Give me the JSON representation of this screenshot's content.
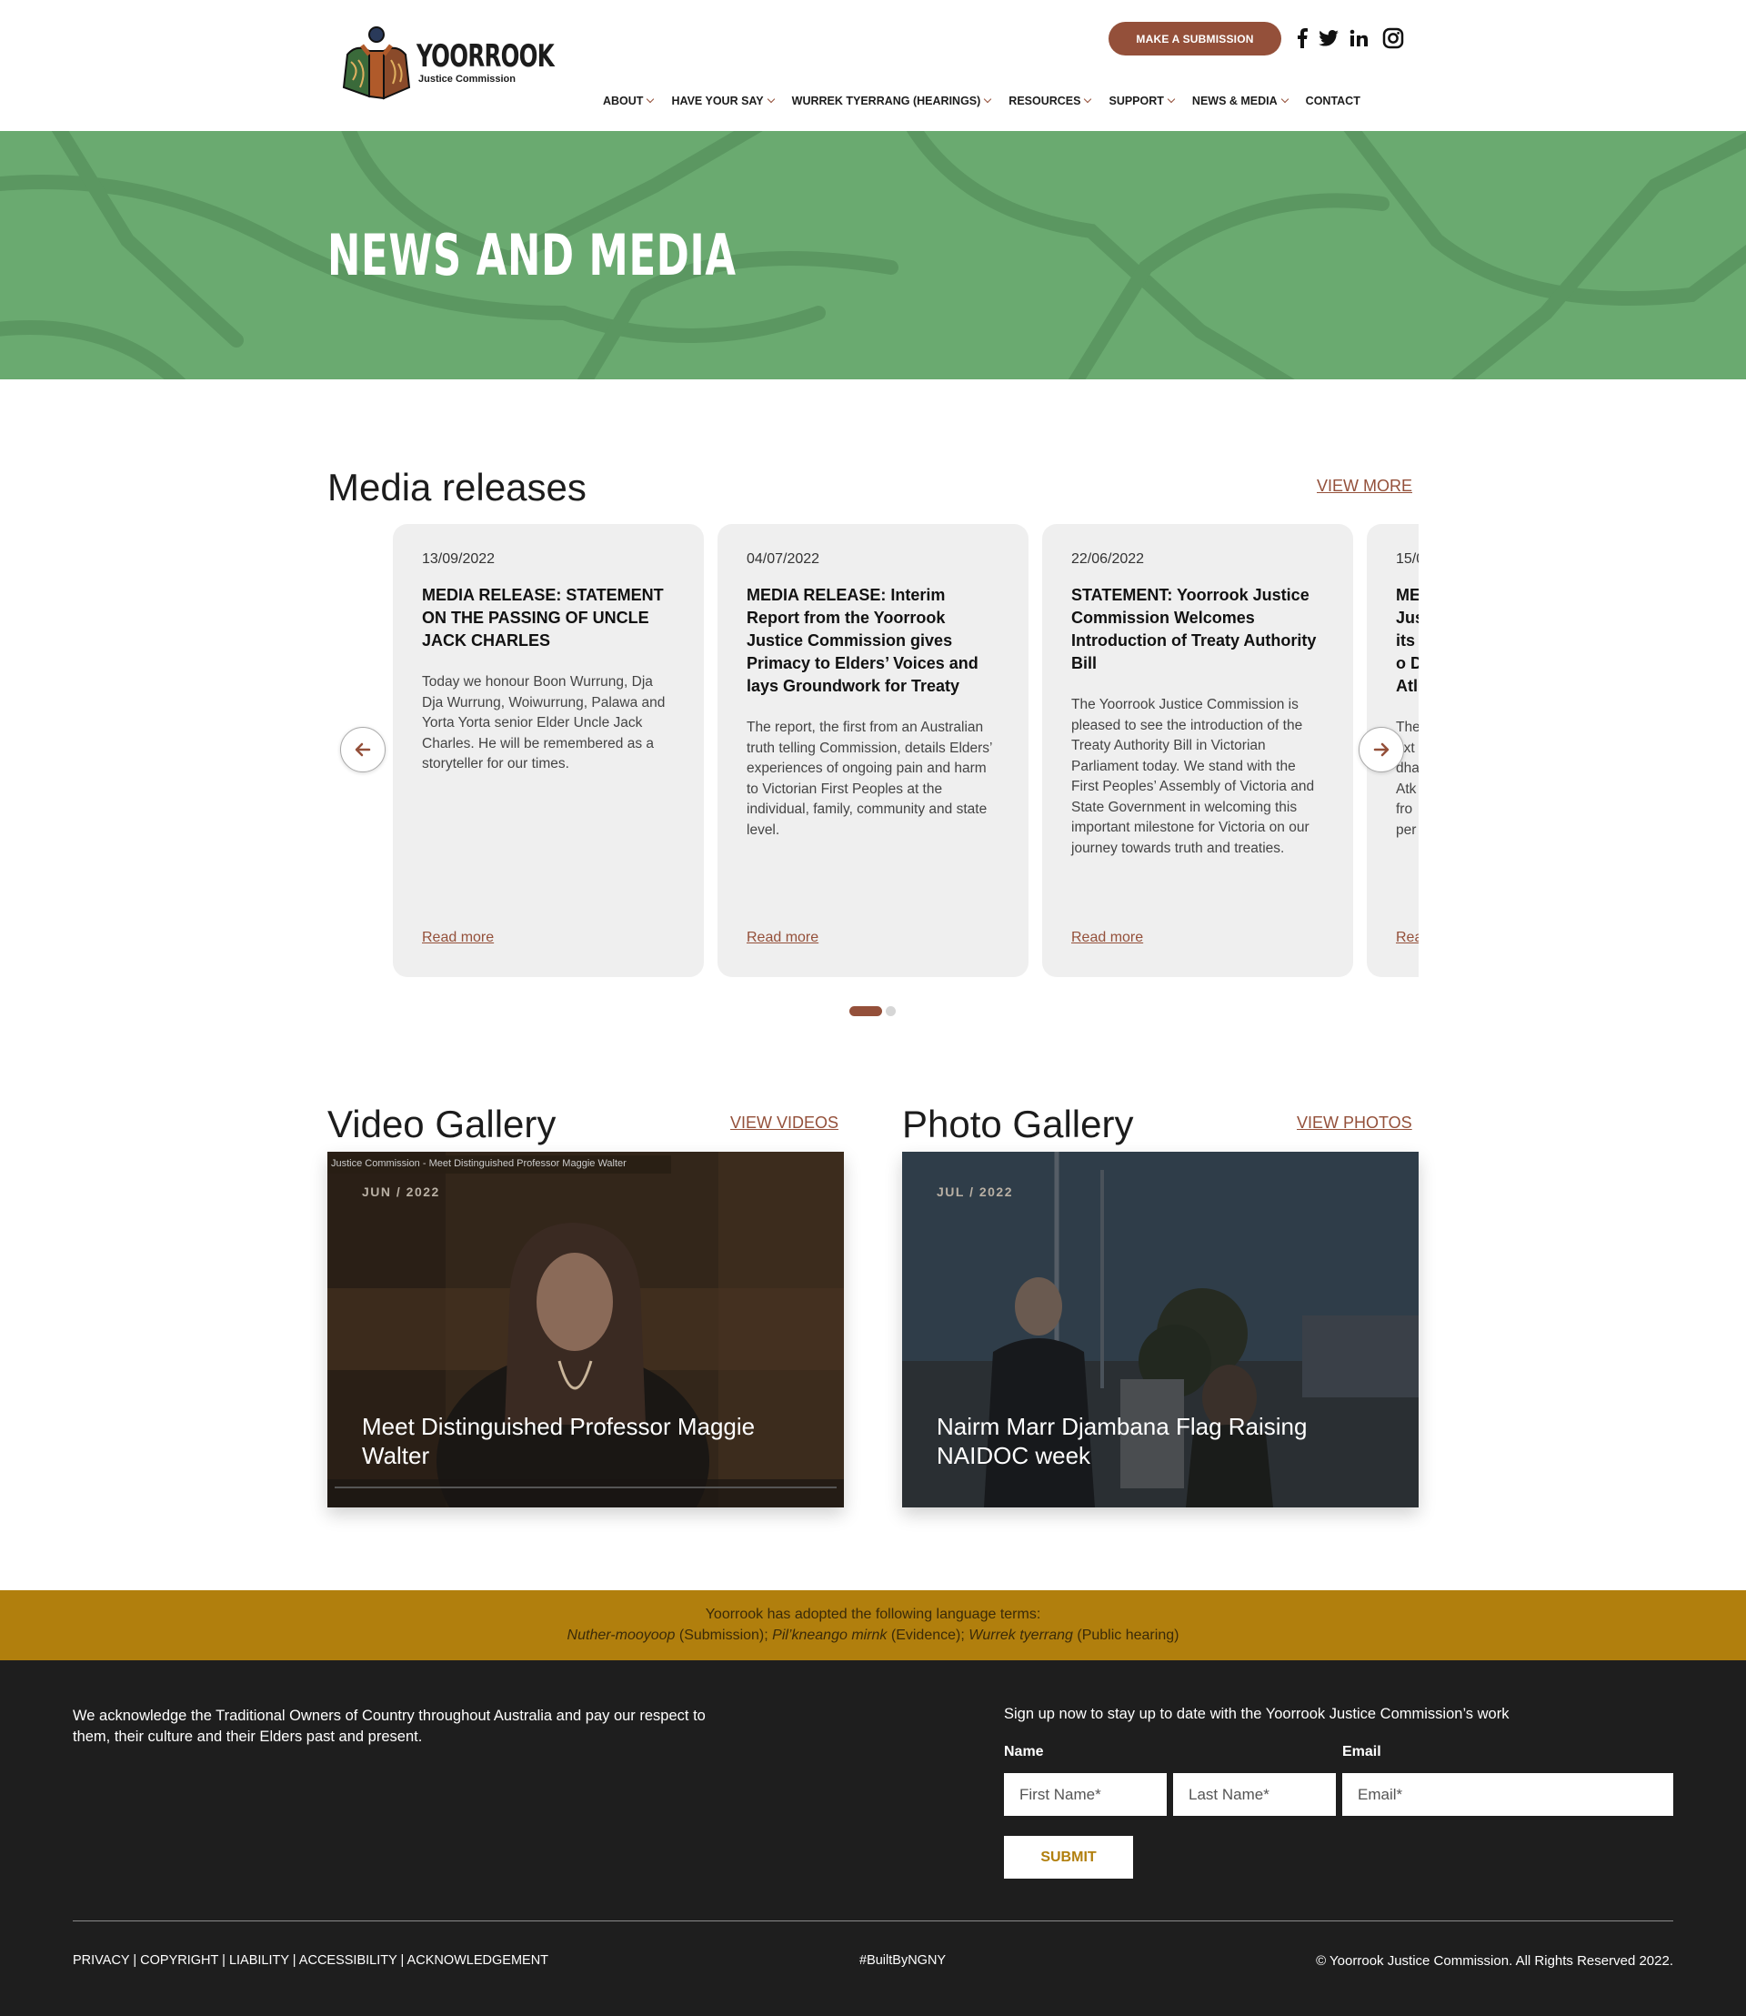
{
  "header": {
    "logo_word": "YOORROOK",
    "logo_sub": "Justice Commission",
    "submission_button": "MAKE A SUBMISSION",
    "social": [
      "facebook-icon",
      "twitter-icon",
      "linkedin-icon",
      "instagram-icon"
    ],
    "nav": [
      {
        "label": "ABOUT",
        "dropdown": true
      },
      {
        "label": "HAVE YOUR SAY",
        "dropdown": true
      },
      {
        "label": "WURREK TYERRANG (HEARINGS)",
        "dropdown": true
      },
      {
        "label": "RESOURCES",
        "dropdown": true
      },
      {
        "label": "SUPPORT",
        "dropdown": true
      },
      {
        "label": "NEWS & MEDIA",
        "dropdown": true
      },
      {
        "label": "CONTACT",
        "dropdown": false
      }
    ]
  },
  "hero": {
    "title": "NEWS AND MEDIA",
    "background_color": "#6aaa70"
  },
  "media_releases": {
    "title": "Media releases",
    "view_more": "VIEW MORE",
    "cards": [
      {
        "date": "13/09/2022",
        "title": "MEDIA RELEASE: STATEMENT ON THE PASSING OF UNCLE JACK CHARLES",
        "text": "Today we honour Boon Wurrung, Dja Dja Wurrung, Woiwurrung, Palawa and Yorta Yorta senior Elder Uncle Jack Charles. He will be remembered as a storyteller for our times.",
        "read_more": "Read more"
      },
      {
        "date": "04/07/2022",
        "title": "MEDIA RELEASE: Interim Report from the Yoorrook Justice Commission gives Primacy to Elders’ Voices and lays Groundwork for Treaty",
        "text": "The report, the first from an Australian truth telling Commission, details Elders’ experiences of ongoing pain and harm to Victorian First Peoples at the individual, family, community and state level.",
        "read_more": "Read more"
      },
      {
        "date": "22/06/2022",
        "title": "STATEMENT: Yoorrook Justice Commission Welcomes Introduction of Treaty Authority Bill",
        "text": "The Yoorrook Justice Commission is pleased to see the introduction of the Treaty Authority Bill in Victorian Parliament today. We stand with the First Peoples’ Assembly of Victoria and State Government in welcoming this important milestone for Victoria on our journey towards truth and treaties.",
        "read_more": "Read more"
      },
      {
        "date": "15/0",
        "title": "ME Jus its Co Dh Atl",
        "text": "The ext dha Atk fro per",
        "read_more": "Rea"
      }
    ],
    "active_slide": 1,
    "total_slides": 2
  },
  "video_gallery": {
    "title": "Video Gallery",
    "view_link": "VIEW VIDEOS",
    "video_bar_text": "Justice Commission - Meet Distinguished Professor Maggie Walter",
    "date": "JUN / 2022",
    "caption": "Meet Distinguished Professor Maggie Walter"
  },
  "photo_gallery": {
    "title": "Photo Gallery",
    "view_link": "VIEW PHOTOS",
    "date": "JUL / 2022",
    "caption": "Nairm Marr Djambana Flag Raising NAIDOC week"
  },
  "language_banner": {
    "line1": "Yoorrook has adopted the following language terms:",
    "term1": "Nuther-mooyoop",
    "def1": " (Submission); ",
    "term2": "Pil’kneango mirnk",
    "def2": " (Evidence); ",
    "term3": "Wurrek tyerrang",
    "def3": " (Public hearing)"
  },
  "footer": {
    "acknowledgement": "We acknowledge the Traditional Owners of Country throughout Australia and pay our respect to them, their culture and their Elders past and present.",
    "signup_heading": "Sign up now to stay up to date with the Yoorrook Justice Commission’s work",
    "name_label": "Name",
    "email_label": "Email",
    "first_name_placeholder": "First Name*",
    "last_name_placeholder": "Last Name*",
    "email_placeholder": "Email*",
    "submit": "SUBMIT",
    "legal_links": [
      "PRIVACY",
      "COPYRIGHT",
      "LIABILITY",
      "ACCESSIBILITY",
      "ACKNOWLEDGEMENT"
    ],
    "built_by": "#BuiltByNGNY",
    "copyright": "© Yoorrook Justice Commission. All Rights Reserved 2022."
  }
}
